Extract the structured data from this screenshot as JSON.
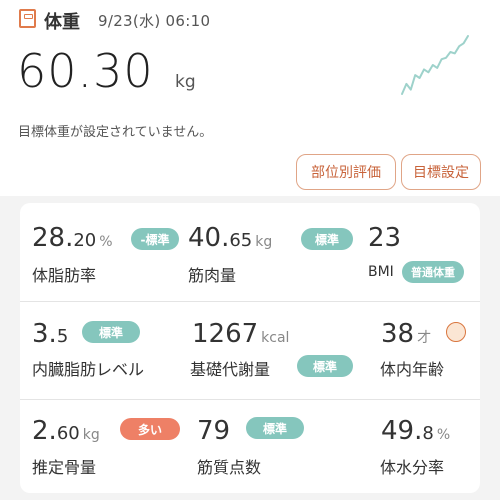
{
  "header": {
    "title": "体重",
    "date": "9/23(水) 06:10"
  },
  "weight": {
    "value": "60.30",
    "unit": "kg"
  },
  "goal_message": "目標体重が設定されていません。",
  "buttons": {
    "part_eval": "部位別評価",
    "goal_setting": "目標設定"
  },
  "metrics": {
    "body_fat": {
      "int": "28.",
      "dec": "20",
      "unit": "%",
      "badge": "-標準",
      "label": "体脂肪率"
    },
    "muscle": {
      "int": "40.",
      "dec": "65",
      "unit": "kg",
      "badge": "標準",
      "label": "筋肉量"
    },
    "bmi": {
      "value": "23",
      "label": "BMI",
      "badge": "普通体重"
    },
    "visceral": {
      "int": "3.",
      "dec": "5",
      "badge": "標準",
      "label": "内臓脂肪レベル"
    },
    "bmr": {
      "value": "1267",
      "unit": "kcal",
      "badge": "標準",
      "label": "基礎代謝量"
    },
    "body_age": {
      "value": "38",
      "unit": "才",
      "label": "体内年齢"
    },
    "bone": {
      "int": "2.",
      "dec": "60",
      "unit": "kg",
      "badge": "多い",
      "label": "推定骨量"
    },
    "muscle_quality": {
      "value": "79",
      "badge": "標準",
      "label": "筋質点数"
    },
    "water": {
      "int": "49.",
      "dec": "8",
      "unit": "%",
      "label": "体水分率"
    }
  },
  "colors": {
    "accent": "#e07b4c",
    "badge_standard": "#85c6bd",
    "badge_high": "#ee8066",
    "trend": "#9ed2cb"
  },
  "icons": {
    "header": "scale-icon",
    "trend": "trend-sparkline",
    "body_age": "face-icon"
  },
  "sparkline": {
    "values": [
      55,
      62,
      58,
      68,
      66,
      72,
      70,
      75,
      73,
      79,
      80,
      84,
      83,
      88,
      90,
      95
    ]
  }
}
